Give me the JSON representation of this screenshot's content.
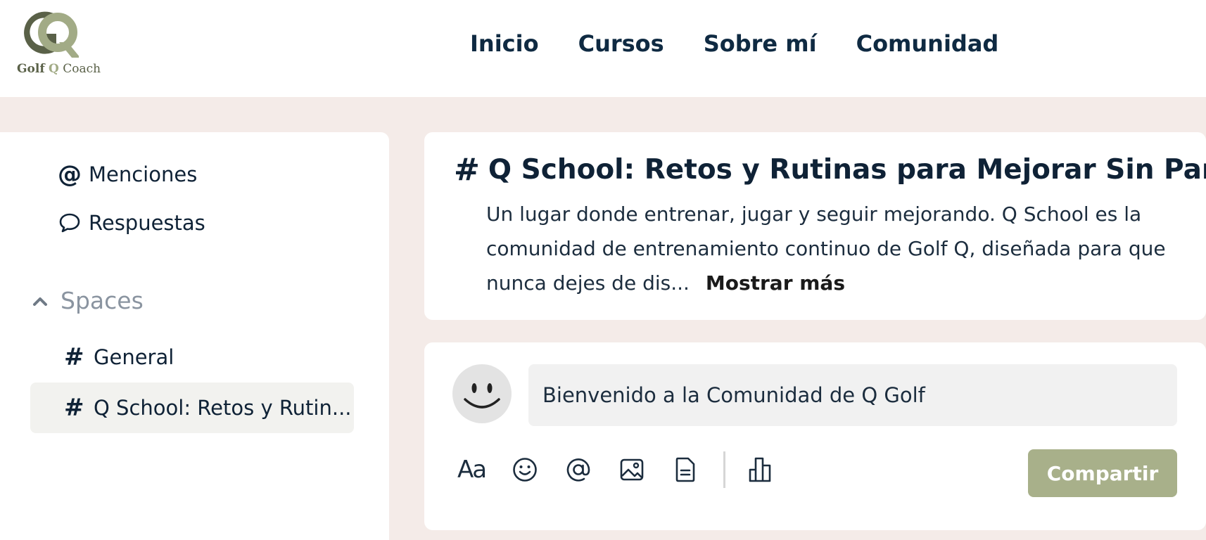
{
  "brand": {
    "logo_word1": "Golf",
    "logo_word2": "Q",
    "logo_word3": "Coach",
    "color_dark": "#5a6148",
    "color_light": "#a2ab86"
  },
  "nav": [
    {
      "label": "Inicio"
    },
    {
      "label": "Cursos"
    },
    {
      "label": "Sobre mí"
    },
    {
      "label": "Comunidad"
    }
  ],
  "sidebar": {
    "mentions": {
      "label": "Menciones",
      "icon": "at-icon"
    },
    "replies": {
      "label": "Respuestas",
      "icon": "speech-bubble-icon"
    },
    "spaces_heading": "Spaces",
    "spaces": [
      {
        "label": "General",
        "active": false
      },
      {
        "label": "Q School: Retos y Rutin...",
        "active": true
      }
    ]
  },
  "space": {
    "title": "Q School: Retos y Rutinas para Mejorar Sin Parar",
    "description": "Un lugar donde entrenar, jugar y seguir mejorando. Q School es la comunidad de entrenamiento continuo de Golf Q, diseñada para que nunca dejes de dis...",
    "show_more": "Mostrar más"
  },
  "composer": {
    "placeholder": "Bienvenido a la Comunidad de Q Golf",
    "tool_text": "Aa",
    "tools": [
      "text-format-icon",
      "emoji-icon",
      "mention-icon",
      "image-icon",
      "document-icon",
      "poll-icon"
    ],
    "submit_label": "Compartir",
    "submit_color": "#a8b08a"
  },
  "colors": {
    "page_bg": "#f4ebe8",
    "card_bg": "#ffffff",
    "text_dark": "#0f2236",
    "muted": "#8a94a0"
  }
}
